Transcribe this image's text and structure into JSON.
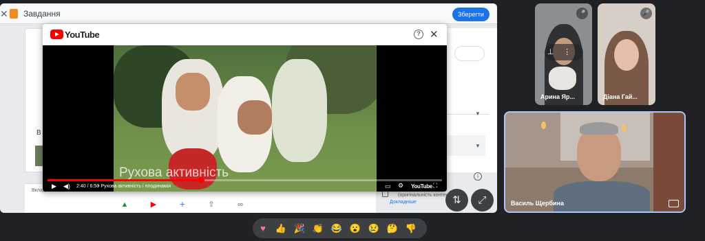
{
  "classroom": {
    "close_icon": "close-icon",
    "title": "Завдання",
    "save_label": "Зберегти",
    "section_label": "В",
    "originality_text": "(оригінальність контен",
    "originality_link": "Докладніше",
    "bottom_label": "Вклад",
    "attach_icons": [
      "google-drive-icon",
      "youtube-icon",
      "add-icon",
      "upload-icon",
      "link-icon"
    ]
  },
  "youtube_modal": {
    "brand": "YouTube",
    "help_icon": "help-icon",
    "close_icon": "close-icon",
    "video_caption": "Рухова активність",
    "time": "2:40 / 6:50",
    "chapter": "• Рухова активність і плодинамія",
    "progress": 0.39,
    "watermark": "YouTube",
    "brand_color": "#ff0000"
  },
  "participants": [
    {
      "name": "Арина Яр...",
      "muted": true
    },
    {
      "name": "Діана Гай...",
      "muted": true
    },
    {
      "name": "Василь Щербина",
      "muted": false
    }
  ],
  "reactions": [
    "sparkling-heart",
    "thumbs-up",
    "party-popper",
    "clapping-hands",
    "laughing-face",
    "surprised-face",
    "sad-face",
    "thinking-face",
    "thumbs-down"
  ],
  "controls": {
    "swap_icon": "swap-vertical-icon",
    "expand_icon": "expand-icon"
  }
}
